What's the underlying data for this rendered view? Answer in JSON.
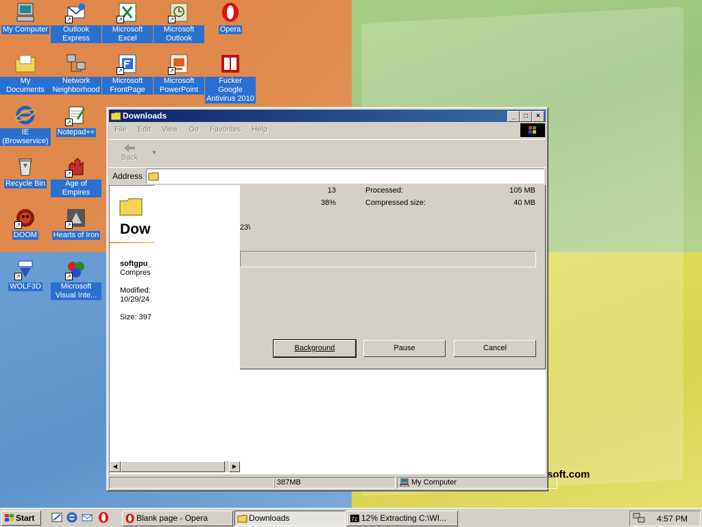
{
  "desktop": {
    "brand_text": "soft.com",
    "icons": [
      {
        "label": "My Computer"
      },
      {
        "label": "Outlook Express"
      },
      {
        "label": "Microsoft Excel"
      },
      {
        "label": "Microsoft Outlook"
      },
      {
        "label": "Opera"
      },
      {
        "label": "My Documents"
      },
      {
        "label": "Network Neighborhood"
      },
      {
        "label": "Microsoft FrontPage"
      },
      {
        "label": "Microsoft PowerPoint"
      },
      {
        "label": "Fucker Google Antivirus 2010"
      },
      {
        "label": "IE (Browservice)"
      },
      {
        "label": "Notepad++"
      },
      {
        "label": "Recycle Bin"
      },
      {
        "label": "Age of Empires"
      },
      {
        "label": "DOOM"
      },
      {
        "label": "Hearts of Iron"
      },
      {
        "label": "WOLF3D"
      },
      {
        "label": "Microsoft Visual Inte..."
      }
    ]
  },
  "window": {
    "title": "Downloads",
    "menu": [
      "File",
      "Edit",
      "View",
      "Go",
      "Favorites",
      "Help"
    ],
    "toolbar": {
      "back_label": "Back"
    },
    "address": {
      "label": "Address",
      "value": ""
    },
    "webview": {
      "title": "Dow",
      "filename": "softgpu_",
      "type": "Compres",
      "modified_label": "Modified:",
      "modified_value": "10/29/24",
      "size": "Size: 397"
    },
    "status": {
      "size": "387MB",
      "zone": "My Computer"
    }
  },
  "extract": {
    "files_value": "13",
    "percent_value": "38%",
    "processed_label": "Processed:",
    "processed_value": "105 MB",
    "compressed_label": "Compressed size:",
    "compressed_value": "40 MB",
    "path_fragment": "23\\",
    "progress": 0.38,
    "buttons": {
      "background": "Background",
      "pause": "Pause",
      "cancel": "Cancel"
    }
  },
  "taskbar": {
    "start_label": "Start",
    "tasks": [
      {
        "label": "Blank page - Opera"
      },
      {
        "label": "Downloads"
      },
      {
        "label": "12% Extracting C:\\WI..."
      }
    ],
    "clock": "4:57 PM"
  },
  "colors": {
    "titlebar_start": "#0a246a",
    "titlebar_end": "#3a6ea5",
    "icon_label_bg": "#2a70d0",
    "face": "#d4d0c8"
  }
}
